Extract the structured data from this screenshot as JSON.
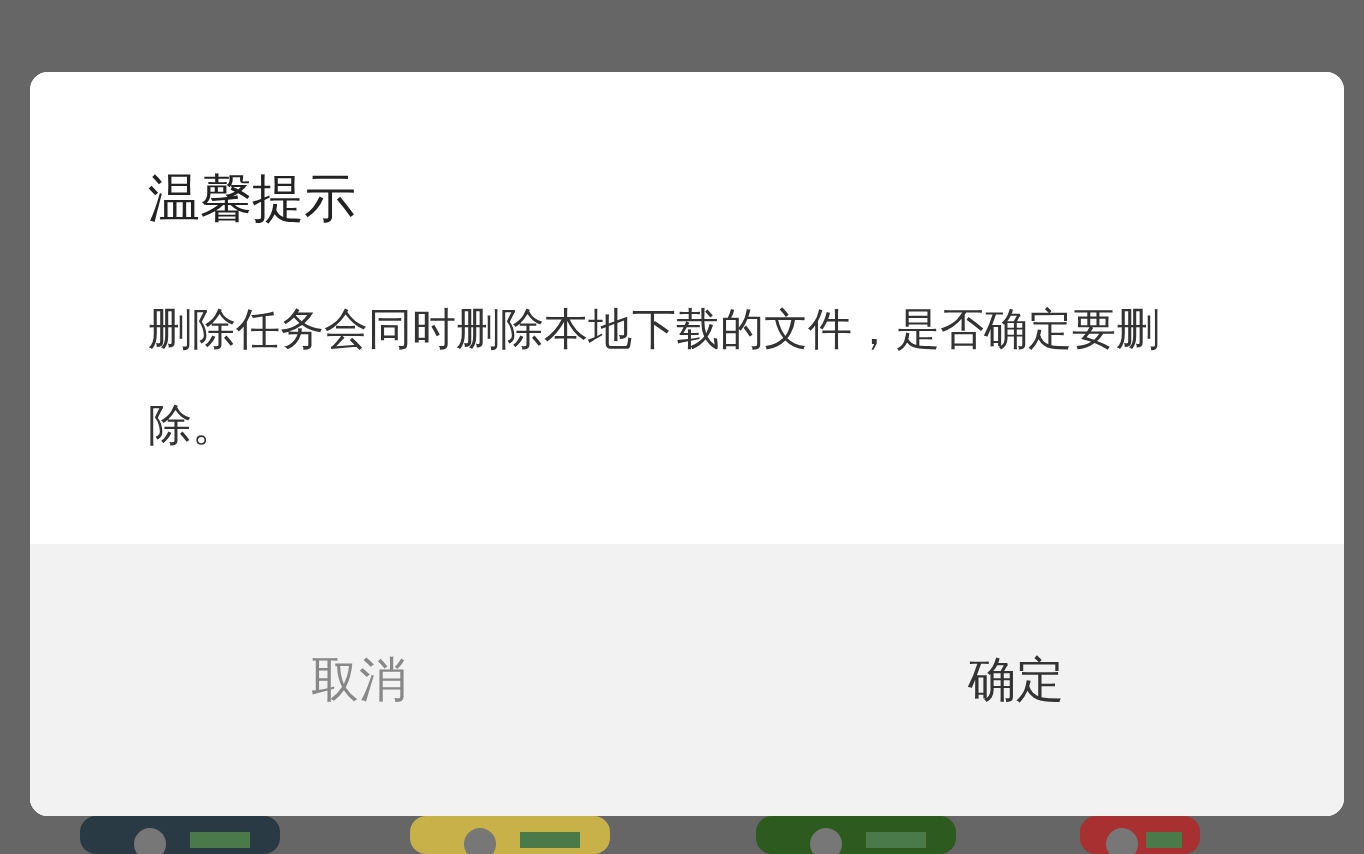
{
  "dialog": {
    "title": "温馨提示",
    "message": "删除任务会同时删除本地下载的文件，是否确定要删除。",
    "buttons": [
      {
        "label": "取消",
        "kind": "cancel"
      },
      {
        "label": "确定",
        "kind": "confirm"
      }
    ]
  }
}
